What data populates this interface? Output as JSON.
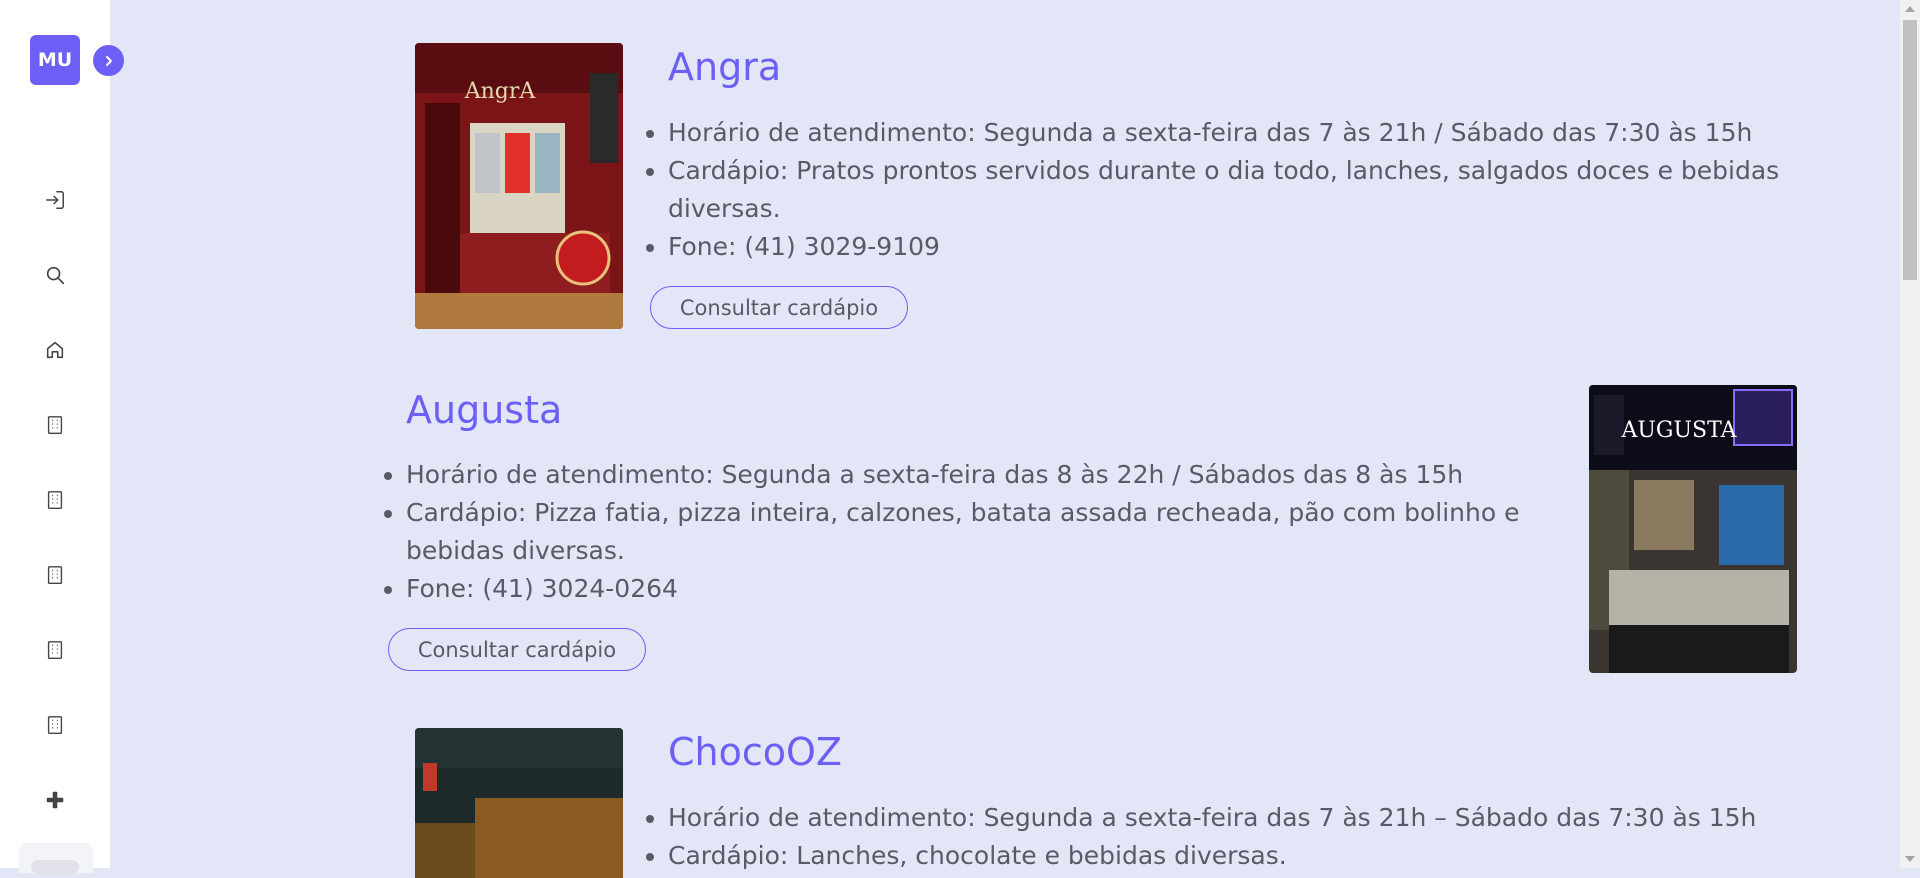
{
  "sidebar": {
    "avatar_initials": "MU",
    "icons": [
      "login-icon",
      "search-icon",
      "home-icon",
      "building-icon",
      "building-icon",
      "building-icon",
      "building-icon",
      "building-icon",
      "plus-icon"
    ]
  },
  "restaurants": [
    {
      "name": "Angra",
      "hours": "Horário de atendimento: Segunda a sexta-feira das 7 às 21h / Sábado das 7:30 às 15h",
      "menu_line1": "Cardápio: Pratos prontos servidos durante o dia todo, lanches, salgados doces e bebidas",
      "menu_line2": "diversas.",
      "phone": "Fone: (41) 3029-9109",
      "button": "Consultar cardápio",
      "photo_sign": "AngrA"
    },
    {
      "name": "Augusta",
      "hours": "Horário de atendimento: Segunda a sexta-feira das 8 às 22h / Sábados das 8 às 15h",
      "menu_line1": "Cardápio: Pizza fatia, pizza inteira, calzones, batata assada recheada, pão com bolinho e",
      "menu_line2": "bebidas diversas.",
      "phone": "Fone: (41) 3024-0264",
      "button": "Consultar cardápio",
      "photo_sign": "AUGUSTA"
    },
    {
      "name": "ChocoOZ",
      "hours": "Horário de atendimento: Segunda a sexta-feira das 7 às 21h – Sábado das 7:30 às 15h",
      "menu_line1": "Cardápio: Lanches, chocolate e bebidas diversas."
    }
  ],
  "colors": {
    "accent": "#6d5ef6",
    "background": "#e3e6f6",
    "text": "#5a5a66"
  }
}
